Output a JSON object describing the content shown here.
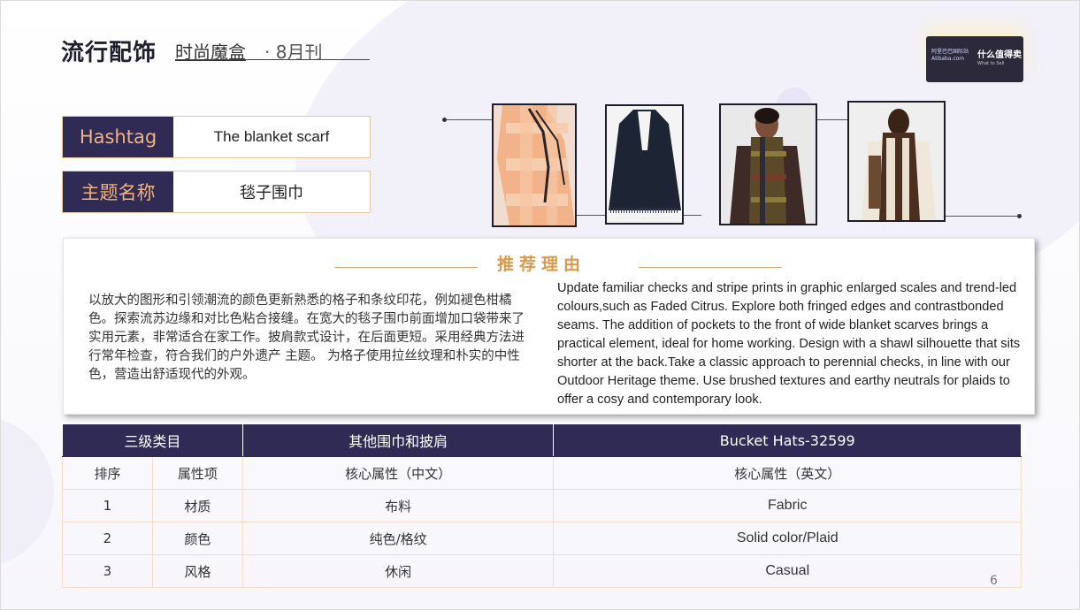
{
  "header": {
    "title": "流行配饰",
    "subtitle": "时尚魔盒",
    "issue": "· 8月刊"
  },
  "logo": {
    "left_text": "阿里巴巴国际站 Alibaba.com",
    "right_text": "什么值得卖",
    "right_small": "What to Sell"
  },
  "info": {
    "hashtag_label": "Hashtag",
    "hashtag_value": "The blanket scarf",
    "theme_label": "主题名称",
    "theme_value": "毯子围巾"
  },
  "reason": {
    "title": "推荐理由",
    "cn": "以放大的图形和引领潮流的颜色更新熟悉的格子和条纹印花，例如褪色柑橘色。探索流苏边缘和对比色粘合接缝。在宽大的毯子围巾前面增加口袋带来了实用元素，非常适合在家工作。披肩款式设计，在后面更短。采用经典方法进行常年检查，符合我们的户外遗产 主题。 为格子使用拉丝纹理和朴实的中性色，营造出舒适现代的外观。",
    "en": "Update familiar checks and stripe prints in graphic enlarged scales and trend-led colours,such as Faded Citrus. Explore both fringed edges and contrastbonded seams. The addition of pockets to the front of wide blanket scarves brings a practical element, ideal for home working. Design with a shawl silhouette that sits shorter at the back.Take a classic approach to perennial checks, in line with our Outdoor Heritage theme. Use brushed textures and earthy neutrals for plaids to offer a cosy and contemporary look."
  },
  "table": {
    "head": [
      "三级类目",
      "其他围巾和披肩",
      "Bucket Hats-32599"
    ],
    "subhead": [
      "排序",
      "属性项",
      "核心属性（中文）",
      "核心属性（英文）"
    ],
    "rows": [
      [
        "1",
        "材质",
        "布料",
        "Fabric"
      ],
      [
        "2",
        "颜色",
        "纯色/格纹",
        "Solid color/Plaid"
      ],
      [
        "3",
        "风格",
        "休闲",
        "Casual"
      ]
    ]
  },
  "page_number": "6"
}
